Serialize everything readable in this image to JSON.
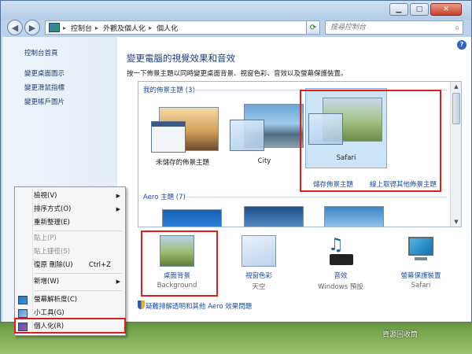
{
  "window": {
    "buttons": {
      "minimize": "▁",
      "maximize": "□",
      "close": "✕"
    }
  },
  "address": {
    "breadcrumbs": [
      "控制台",
      "外觀及個人化",
      "個人化"
    ],
    "search_placeholder": "搜尋控制台"
  },
  "sidebar": {
    "links": [
      "控制台首頁",
      "變更桌面圖示",
      "變更滑鼠指標",
      "變更帳戶圖片"
    ]
  },
  "main": {
    "title": "變更電腦的視覺效果和音效",
    "description": "按一下佈景主題以同時變更桌面背景、視窗色彩、音效以及螢幕保護裝置。",
    "my_themes_header": "我的佈景主題 (3)",
    "aero_header": "Aero 主題 (7)",
    "themes": [
      {
        "label": "未儲存的佈景主題"
      },
      {
        "label": "City"
      },
      {
        "label": "Safari"
      }
    ],
    "save_theme_link": "儲存佈景主題",
    "online_themes_link": "線上取得其他佈景主題"
  },
  "bottom": {
    "items": [
      {
        "title": "桌面背景",
        "subtitle": "Background"
      },
      {
        "title": "視窗色彩",
        "subtitle": "天空"
      },
      {
        "title": "音效",
        "subtitle": "Windows 預設"
      },
      {
        "title": "螢幕保護裝置",
        "subtitle": "Safari"
      }
    ],
    "aero_troubleshoot": "疑難排解透明和其他 Aero 效果問題"
  },
  "context_menu": {
    "items": [
      {
        "label": "檢視(V)"
      },
      {
        "label": "排序方式(O)"
      },
      {
        "label": "重新整理(E)"
      },
      {
        "label": "貼上(P)"
      },
      {
        "label": "貼上捷徑(S)"
      },
      {
        "label": "復原 刪除(U)",
        "shortcut": "Ctrl+Z"
      },
      {
        "label": "新增(W)"
      },
      {
        "label": "螢幕解析度(C)"
      },
      {
        "label": "小工具(G)"
      },
      {
        "label": "個人化(R)"
      }
    ]
  },
  "desktop": {
    "recycle_bin_label": "資源回收筒"
  },
  "colors": {
    "link": "#1d4ea5",
    "highlight_red": "#e21b1b"
  }
}
